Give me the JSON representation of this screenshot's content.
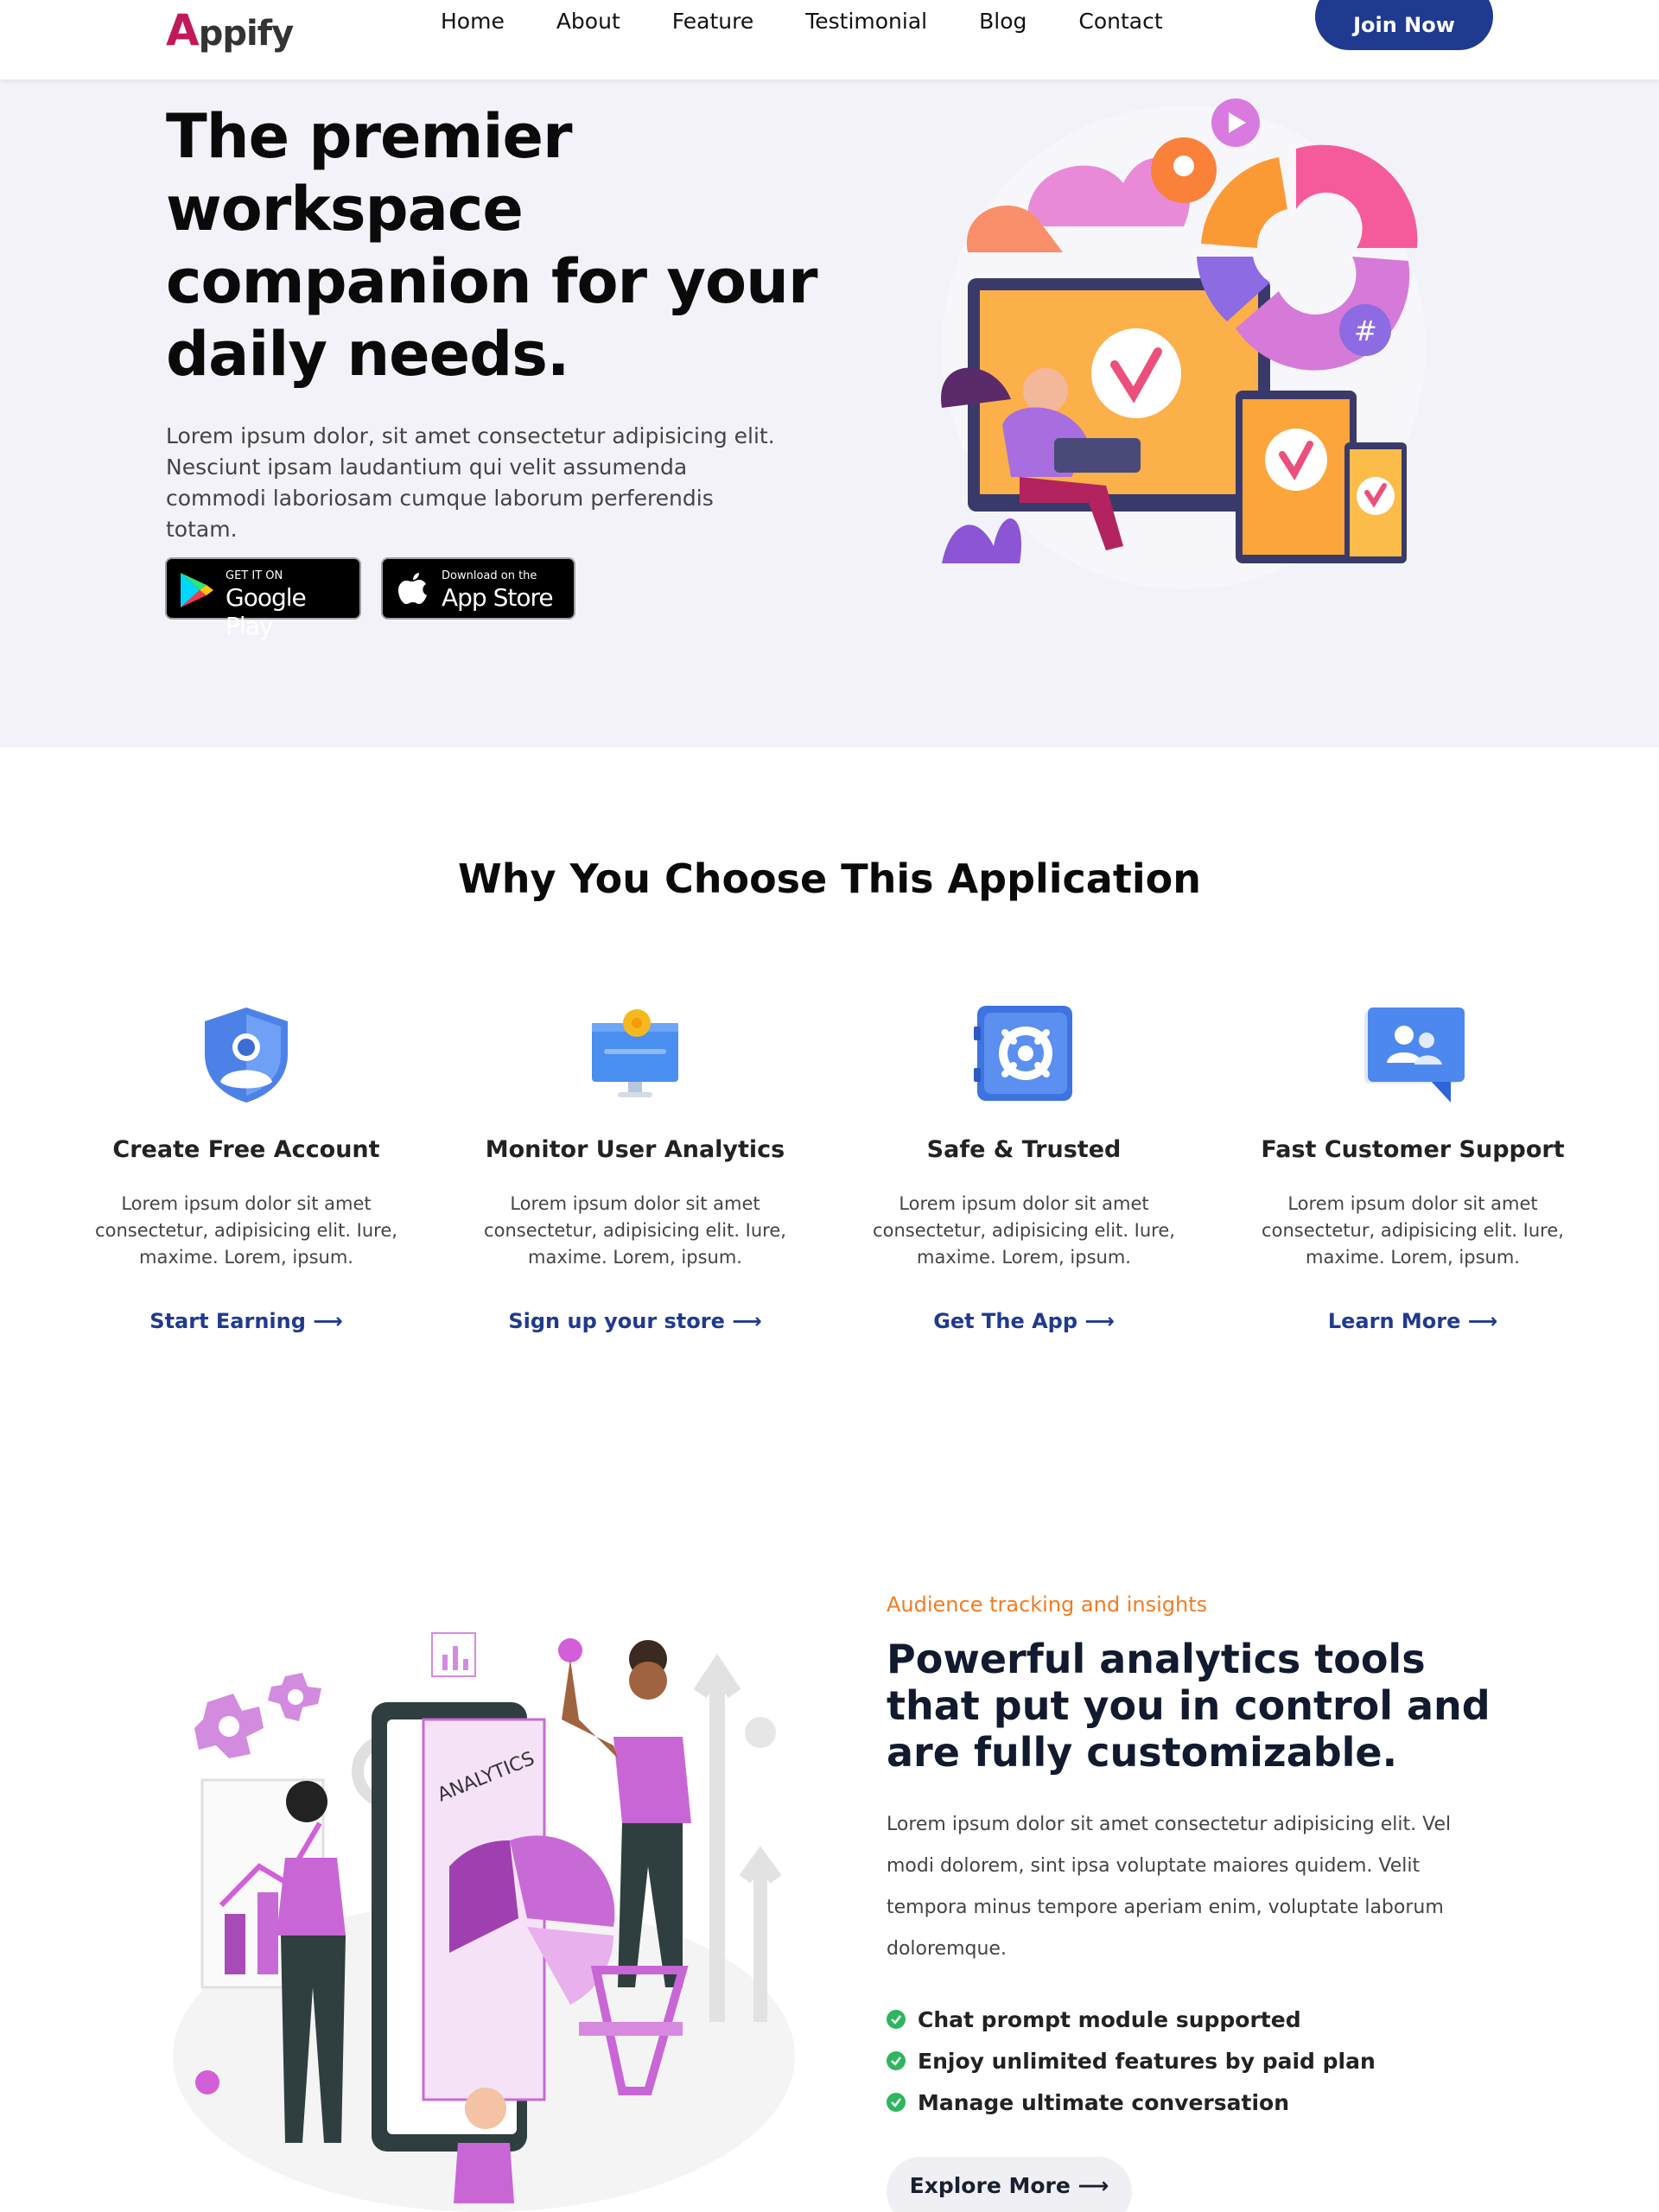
{
  "nav": {
    "logo_first": "A",
    "logo_rest": "ppify",
    "items": [
      "Home",
      "About",
      "Feature",
      "Testimonial",
      "Blog",
      "Contact"
    ],
    "cta": "Join Now"
  },
  "hero": {
    "title": "The premier workspace companion for your daily needs.",
    "description": "Lorem ipsum dolor, sit amet consectetur adipisicing elit. Nesciunt ipsam laudantium qui velit assumenda commodi laboriosam cumque laborum perferendis totam.",
    "google_play": {
      "small": "GET IT ON",
      "big": "Google Play"
    },
    "app_store": {
      "small": "Download on the",
      "big": "App Store"
    }
  },
  "why": {
    "title": "Why You Choose This Application",
    "features": [
      {
        "title": "Create Free Account",
        "text": "Lorem ipsum dolor sit amet consectetur, adipisicing elit. Iure, maxime. Lorem, ipsum.",
        "link": "Start Earning ⟶",
        "icon": "user-shield-icon"
      },
      {
        "title": "Monitor User Analytics",
        "text": "Lorem ipsum dolor sit amet consectetur, adipisicing elit. Iure, maxime. Lorem, ipsum.",
        "link": "Sign up your store ⟶",
        "icon": "monitor-icon"
      },
      {
        "title": "Safe & Trusted",
        "text": "Lorem ipsum dolor sit amet consectetur, adipisicing elit. Iure, maxime. Lorem, ipsum.",
        "link": "Get The App ⟶",
        "icon": "vault-icon"
      },
      {
        "title": "Fast Customer Support",
        "text": "Lorem ipsum dolor sit amet consectetur, adipisicing elit. Iure, maxime. Lorem, ipsum.",
        "link": "Learn More ⟶",
        "icon": "support-chat-icon"
      }
    ]
  },
  "analytics": {
    "eyebrow": "Audience tracking and insights",
    "title": "Powerful analytics tools that put you in control and are fully customizable.",
    "description": "Lorem ipsum dolor sit amet consectetur adipisicing elit. Vel modi dolorem, sint ipsa voluptate maiores quidem. Velit tempora minus tempore aperiam enim, voluptate laborum doloremque.",
    "illustration_label": "ANALYTICS",
    "checks": [
      "Chat prompt module supported",
      "Enjoy unlimited features by paid plan",
      "Manage ultimate conversation"
    ],
    "cta": "Explore More ⟶"
  },
  "colors": {
    "brand": "#c2185b",
    "primary": "#203a8f",
    "accent": "#f47b20",
    "check": "#2fb55d",
    "hero_bg": "#f3f2f8"
  }
}
